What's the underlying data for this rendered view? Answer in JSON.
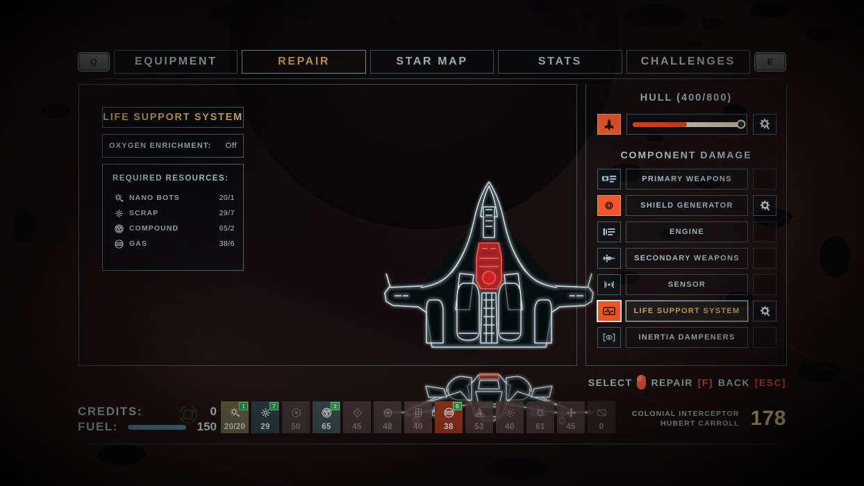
{
  "nav": {
    "left_key": "Q",
    "right_key": "E",
    "tabs": [
      {
        "label": "EQUIPMENT",
        "active": false
      },
      {
        "label": "REPAIR",
        "active": true
      },
      {
        "label": "STAR MAP",
        "active": false
      },
      {
        "label": "STATS",
        "active": false
      },
      {
        "label": "CHALLENGES",
        "active": false
      }
    ]
  },
  "left_panel": {
    "system_title": "LIFE SUPPORT SYSTEM",
    "oxygen": {
      "label": "OXYGEN ENRICHMENT:",
      "value": "Off"
    },
    "resources_header": "REQUIRED RESOURCES:",
    "resources": [
      {
        "icon": "nanobots-icon",
        "name": "NANO BOTS",
        "amount": "20/1"
      },
      {
        "icon": "scrap-icon",
        "name": "SCRAP",
        "amount": "29/7"
      },
      {
        "icon": "compound-icon",
        "name": "COMPOUND",
        "amount": "65/2"
      },
      {
        "icon": "gas-icon",
        "name": "GAS",
        "amount": "38/6"
      }
    ]
  },
  "right_panel": {
    "hull_title": "HULL (400/800)",
    "hull_percent": 50,
    "hull_icon": "ship-hull-icon",
    "hull_repair_icon": "gear-wrench-icon",
    "component_damage_title": "COMPONENT DAMAGE",
    "components": [
      {
        "label": "PRIMARY WEAPONS",
        "icon": "primary-weapons-icon",
        "damaged": false,
        "selected": false,
        "repairable": false
      },
      {
        "label": "SHIELD GENERATOR",
        "icon": "shield-generator-icon",
        "damaged": true,
        "selected": false,
        "repairable": true
      },
      {
        "label": "ENGINE",
        "icon": "engine-icon",
        "damaged": false,
        "selected": false,
        "repairable": false
      },
      {
        "label": "SECONDARY WEAPONS",
        "icon": "secondary-weapons-icon",
        "damaged": false,
        "selected": false,
        "repairable": false
      },
      {
        "label": "SENSOR",
        "icon": "sensor-icon",
        "damaged": false,
        "selected": false,
        "repairable": false
      },
      {
        "label": "LIFE SUPPORT SYSTEM",
        "icon": "life-support-icon",
        "damaged": true,
        "selected": true,
        "repairable": true
      },
      {
        "label": "INERTIA DAMPENERS",
        "icon": "inertia-dampeners-icon",
        "damaged": false,
        "selected": false,
        "repairable": false
      }
    ]
  },
  "hints": {
    "select_label": "SELECT",
    "mouse_icon": "mouse-left-click-icon",
    "repair_label": "REPAIR",
    "repair_key": "[F]",
    "back_label": "BACK",
    "back_key": "[ESC]"
  },
  "bottom": {
    "credits_label": "CREDITS:",
    "credits_value": "0",
    "fuel_label": "FUEL:",
    "fuel_value": "150",
    "fuel_percent": 100,
    "slots": [
      {
        "icon": "nanobots-icon",
        "count": "20/20",
        "badge": "1",
        "tint": "#6e6a48",
        "active": true
      },
      {
        "icon": "scrap-icon",
        "count": "29",
        "badge": "7",
        "tint": "#30424c",
        "active": true
      },
      {
        "icon": "fuelcell-icon",
        "count": "50",
        "badge": "",
        "tint": "#4a3c3a",
        "active": false
      },
      {
        "icon": "compound-icon",
        "count": "65",
        "badge": "2",
        "tint": "#3b4d52",
        "active": true
      },
      {
        "icon": "energy-icon",
        "count": "45",
        "badge": "",
        "tint": "#4a3a38",
        "active": false
      },
      {
        "icon": "chip-icon",
        "count": "48",
        "badge": "",
        "tint": "#4b3c3a",
        "active": false
      },
      {
        "icon": "alloy-icon",
        "count": "40",
        "badge": "",
        "tint": "#56403c",
        "active": false
      },
      {
        "icon": "gas-icon",
        "count": "38",
        "badge": "6",
        "tint": "#97361f",
        "active": true
      },
      {
        "icon": "biomass-icon",
        "count": "53",
        "badge": "",
        "tint": "#503c39",
        "active": false
      },
      {
        "icon": "plasma-icon",
        "count": "40",
        "badge": "",
        "tint": "#513c39",
        "active": false
      },
      {
        "icon": "vortex-icon",
        "count": "61",
        "badge": "",
        "tint": "#4d3a38",
        "active": false
      },
      {
        "icon": "molecule-icon",
        "count": "45",
        "badge": "",
        "tint": "#4d3a38",
        "active": false
      },
      {
        "icon": "empty-slot-icon",
        "count": "0",
        "badge": "",
        "tint": "#332826",
        "active": false
      }
    ],
    "ship_class": "COLONIAL INTERCEPTOR",
    "pilot_name": "HUBERT CARROLL",
    "score": "178"
  },
  "colors": {
    "accent_gold": "#e3b765",
    "accent_orange": "#f2501a",
    "frame_cyan": "#6896a5",
    "text_blue": "#b5c7ce",
    "danger_red": "#f0543a",
    "badge_green": "#2fa355",
    "fuel_teal": "#5c92a6"
  }
}
